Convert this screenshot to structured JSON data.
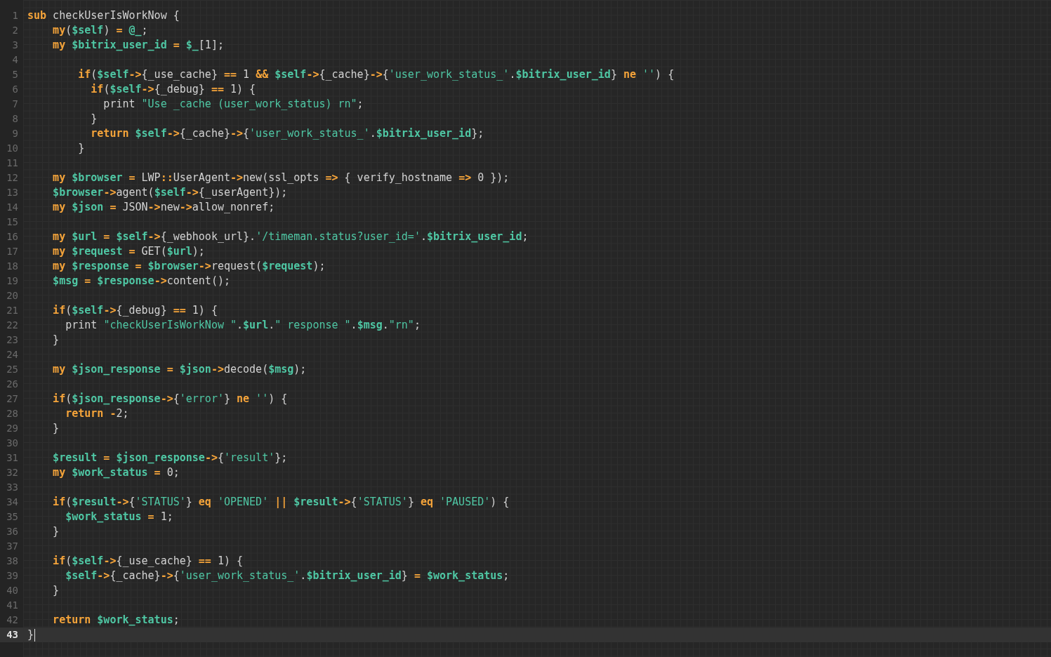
{
  "lines": [
    {
      "number": "1",
      "active": false,
      "tokens": [
        {
          "kind": "kw",
          "text": "sub"
        },
        {
          "kind": "text",
          "text": " checkUserIsWorkNow {"
        }
      ]
    },
    {
      "number": "2",
      "active": false,
      "tokens": [
        {
          "kind": "kw",
          "text": "    my"
        },
        {
          "kind": "text",
          "text": "("
        },
        {
          "kind": "var",
          "text": "$self"
        },
        {
          "kind": "text",
          "text": ") "
        },
        {
          "kind": "kw",
          "text": "="
        },
        {
          "kind": "var",
          "text": " @_"
        },
        {
          "kind": "text",
          "text": ";"
        }
      ]
    },
    {
      "number": "3",
      "active": false,
      "tokens": [
        {
          "kind": "kw",
          "text": "    my"
        },
        {
          "kind": "var",
          "text": " $bitrix_user_id"
        },
        {
          "kind": "kw",
          "text": " ="
        },
        {
          "kind": "var",
          "text": " $_"
        },
        {
          "kind": "text",
          "text": "[1];"
        }
      ]
    },
    {
      "number": "4",
      "active": false
    },
    {
      "number": "5",
      "active": false,
      "tokens": [
        {
          "kind": "kw",
          "text": "        if"
        },
        {
          "kind": "text",
          "text": "("
        },
        {
          "kind": "var",
          "text": "$self"
        },
        {
          "kind": "kw",
          "text": "->"
        },
        {
          "kind": "text",
          "text": "{_use_cache} "
        },
        {
          "kind": "kw",
          "text": "=="
        },
        {
          "kind": "text",
          "text": " 1 "
        },
        {
          "kind": "kw",
          "text": "&&"
        },
        {
          "kind": "var",
          "text": " $self"
        },
        {
          "kind": "kw",
          "text": "->"
        },
        {
          "kind": "text",
          "text": "{_cache}"
        },
        {
          "kind": "kw",
          "text": "->"
        },
        {
          "kind": "text",
          "text": "{"
        },
        {
          "kind": "str",
          "text": "'user_work_status_'"
        },
        {
          "kind": "text",
          "text": "."
        },
        {
          "kind": "var",
          "text": "$bitrix_user_id"
        },
        {
          "kind": "text",
          "text": "} "
        },
        {
          "kind": "kw",
          "text": "ne"
        },
        {
          "kind": "str",
          "text": " ''"
        },
        {
          "kind": "text",
          "text": ") {"
        }
      ]
    },
    {
      "number": "6",
      "active": false,
      "tokens": [
        {
          "kind": "kw",
          "text": "          if"
        },
        {
          "kind": "text",
          "text": "("
        },
        {
          "kind": "var",
          "text": "$self"
        },
        {
          "kind": "kw",
          "text": "->"
        },
        {
          "kind": "text",
          "text": "{_debug} "
        },
        {
          "kind": "kw",
          "text": "=="
        },
        {
          "kind": "text",
          "text": " 1) {"
        }
      ]
    },
    {
      "number": "7",
      "active": false,
      "tokens": [
        {
          "kind": "text",
          "text": "            print "
        },
        {
          "kind": "str",
          "text": "\"Use _cache (user_work_status) rn\""
        },
        {
          "kind": "text",
          "text": ";"
        }
      ]
    },
    {
      "number": "8",
      "active": false,
      "tokens": [
        {
          "kind": "text",
          "text": "          }"
        }
      ]
    },
    {
      "number": "9",
      "active": false,
      "tokens": [
        {
          "kind": "kw",
          "text": "          return"
        },
        {
          "kind": "var",
          "text": " $self"
        },
        {
          "kind": "kw",
          "text": "->"
        },
        {
          "kind": "text",
          "text": "{_cache}"
        },
        {
          "kind": "kw",
          "text": "->"
        },
        {
          "kind": "text",
          "text": "{"
        },
        {
          "kind": "str",
          "text": "'user_work_status_'"
        },
        {
          "kind": "text",
          "text": "."
        },
        {
          "kind": "var",
          "text": "$bitrix_user_id"
        },
        {
          "kind": "text",
          "text": "};"
        }
      ]
    },
    {
      "number": "10",
      "active": false,
      "tokens": [
        {
          "kind": "text",
          "text": "        }"
        }
      ]
    },
    {
      "number": "11",
      "active": false
    },
    {
      "number": "12",
      "active": false,
      "tokens": [
        {
          "kind": "kw",
          "text": "    my"
        },
        {
          "kind": "var",
          "text": " $browser"
        },
        {
          "kind": "kw",
          "text": " ="
        },
        {
          "kind": "text",
          "text": " LWP"
        },
        {
          "kind": "kw",
          "text": "::"
        },
        {
          "kind": "text",
          "text": "UserAgent"
        },
        {
          "kind": "kw",
          "text": "->"
        },
        {
          "kind": "text",
          "text": "new(ssl_opts "
        },
        {
          "kind": "kw",
          "text": "=>"
        },
        {
          "kind": "text",
          "text": " { verify_hostname "
        },
        {
          "kind": "kw",
          "text": "=>"
        },
        {
          "kind": "text",
          "text": " 0 });"
        }
      ]
    },
    {
      "number": "13",
      "active": false,
      "tokens": [
        {
          "kind": "var",
          "text": "    $browser"
        },
        {
          "kind": "kw",
          "text": "->"
        },
        {
          "kind": "text",
          "text": "agent("
        },
        {
          "kind": "var",
          "text": "$self"
        },
        {
          "kind": "kw",
          "text": "->"
        },
        {
          "kind": "text",
          "text": "{_userAgent});"
        }
      ]
    },
    {
      "number": "14",
      "active": false,
      "tokens": [
        {
          "kind": "kw",
          "text": "    my"
        },
        {
          "kind": "var",
          "text": " $json"
        },
        {
          "kind": "kw",
          "text": " ="
        },
        {
          "kind": "text",
          "text": " JSON"
        },
        {
          "kind": "kw",
          "text": "->"
        },
        {
          "kind": "text",
          "text": "new"
        },
        {
          "kind": "kw",
          "text": "->"
        },
        {
          "kind": "text",
          "text": "allow_nonref;"
        }
      ]
    },
    {
      "number": "15",
      "active": false
    },
    {
      "number": "16",
      "active": false,
      "tokens": [
        {
          "kind": "kw",
          "text": "    my"
        },
        {
          "kind": "var",
          "text": " $url"
        },
        {
          "kind": "kw",
          "text": " ="
        },
        {
          "kind": "var",
          "text": " $self"
        },
        {
          "kind": "kw",
          "text": "->"
        },
        {
          "kind": "text",
          "text": "{_webhook_url}."
        },
        {
          "kind": "str",
          "text": "'/timeman.status?user_id='"
        },
        {
          "kind": "text",
          "text": "."
        },
        {
          "kind": "var",
          "text": "$bitrix_user_id"
        },
        {
          "kind": "text",
          "text": ";"
        }
      ]
    },
    {
      "number": "17",
      "active": false,
      "tokens": [
        {
          "kind": "kw",
          "text": "    my"
        },
        {
          "kind": "var",
          "text": " $request"
        },
        {
          "kind": "kw",
          "text": " ="
        },
        {
          "kind": "text",
          "text": " GET("
        },
        {
          "kind": "var",
          "text": "$url"
        },
        {
          "kind": "text",
          "text": ");"
        }
      ]
    },
    {
      "number": "18",
      "active": false,
      "tokens": [
        {
          "kind": "kw",
          "text": "    my"
        },
        {
          "kind": "var",
          "text": " $response"
        },
        {
          "kind": "kw",
          "text": " ="
        },
        {
          "kind": "var",
          "text": " $browser"
        },
        {
          "kind": "kw",
          "text": "->"
        },
        {
          "kind": "text",
          "text": "request("
        },
        {
          "kind": "var",
          "text": "$request"
        },
        {
          "kind": "text",
          "text": ");"
        }
      ]
    },
    {
      "number": "19",
      "active": false,
      "tokens": [
        {
          "kind": "var",
          "text": "    $msg"
        },
        {
          "kind": "kw",
          "text": " ="
        },
        {
          "kind": "var",
          "text": " $response"
        },
        {
          "kind": "kw",
          "text": "->"
        },
        {
          "kind": "text",
          "text": "content();"
        }
      ]
    },
    {
      "number": "20",
      "active": false
    },
    {
      "number": "21",
      "active": false,
      "tokens": [
        {
          "kind": "kw",
          "text": "    if"
        },
        {
          "kind": "text",
          "text": "("
        },
        {
          "kind": "var",
          "text": "$self"
        },
        {
          "kind": "kw",
          "text": "->"
        },
        {
          "kind": "text",
          "text": "{_debug} "
        },
        {
          "kind": "kw",
          "text": "=="
        },
        {
          "kind": "text",
          "text": " 1) {"
        }
      ]
    },
    {
      "number": "22",
      "active": false,
      "tokens": [
        {
          "kind": "text",
          "text": "      print "
        },
        {
          "kind": "str",
          "text": "\"checkUserIsWorkNow \""
        },
        {
          "kind": "text",
          "text": "."
        },
        {
          "kind": "var",
          "text": "$url"
        },
        {
          "kind": "text",
          "text": "."
        },
        {
          "kind": "str",
          "text": "\" response \""
        },
        {
          "kind": "text",
          "text": "."
        },
        {
          "kind": "var",
          "text": "$msg"
        },
        {
          "kind": "text",
          "text": "."
        },
        {
          "kind": "str",
          "text": "\"rn\""
        },
        {
          "kind": "text",
          "text": ";"
        }
      ]
    },
    {
      "number": "23",
      "active": false,
      "tokens": [
        {
          "kind": "text",
          "text": "    }"
        }
      ]
    },
    {
      "number": "24",
      "active": false
    },
    {
      "number": "25",
      "active": false,
      "tokens": [
        {
          "kind": "kw",
          "text": "    my"
        },
        {
          "kind": "var",
          "text": " $json_response"
        },
        {
          "kind": "kw",
          "text": " ="
        },
        {
          "kind": "var",
          "text": " $json"
        },
        {
          "kind": "kw",
          "text": "->"
        },
        {
          "kind": "text",
          "text": "decode("
        },
        {
          "kind": "var",
          "text": "$msg"
        },
        {
          "kind": "text",
          "text": ");"
        }
      ]
    },
    {
      "number": "26",
      "active": false
    },
    {
      "number": "27",
      "active": false,
      "tokens": [
        {
          "kind": "kw",
          "text": "    if"
        },
        {
          "kind": "text",
          "text": "("
        },
        {
          "kind": "var",
          "text": "$json_response"
        },
        {
          "kind": "kw",
          "text": "->"
        },
        {
          "kind": "text",
          "text": "{"
        },
        {
          "kind": "str",
          "text": "'error'"
        },
        {
          "kind": "text",
          "text": "} "
        },
        {
          "kind": "kw",
          "text": "ne"
        },
        {
          "kind": "str",
          "text": " ''"
        },
        {
          "kind": "text",
          "text": ") {"
        }
      ]
    },
    {
      "number": "28",
      "active": false,
      "tokens": [
        {
          "kind": "kw",
          "text": "      return"
        },
        {
          "kind": "kw",
          "text": " -"
        },
        {
          "kind": "text",
          "text": "2;"
        }
      ]
    },
    {
      "number": "29",
      "active": false,
      "tokens": [
        {
          "kind": "text",
          "text": "    }"
        }
      ]
    },
    {
      "number": "30",
      "active": false
    },
    {
      "number": "31",
      "active": false,
      "tokens": [
        {
          "kind": "var",
          "text": "    $result"
        },
        {
          "kind": "kw",
          "text": " ="
        },
        {
          "kind": "var",
          "text": " $json_response"
        },
        {
          "kind": "kw",
          "text": "->"
        },
        {
          "kind": "text",
          "text": "{"
        },
        {
          "kind": "str",
          "text": "'result'"
        },
        {
          "kind": "text",
          "text": "};"
        }
      ]
    },
    {
      "number": "32",
      "active": false,
      "tokens": [
        {
          "kind": "kw",
          "text": "    my"
        },
        {
          "kind": "var",
          "text": " $work_status"
        },
        {
          "kind": "kw",
          "text": " ="
        },
        {
          "kind": "text",
          "text": " 0;"
        }
      ]
    },
    {
      "number": "33",
      "active": false
    },
    {
      "number": "34",
      "active": false,
      "tokens": [
        {
          "kind": "kw",
          "text": "    if"
        },
        {
          "kind": "text",
          "text": "("
        },
        {
          "kind": "var",
          "text": "$result"
        },
        {
          "kind": "kw",
          "text": "->"
        },
        {
          "kind": "text",
          "text": "{"
        },
        {
          "kind": "str",
          "text": "'STATUS'"
        },
        {
          "kind": "text",
          "text": "} "
        },
        {
          "kind": "kw",
          "text": "eq"
        },
        {
          "kind": "str",
          "text": " 'OPENED'"
        },
        {
          "kind": "kw",
          "text": " ||"
        },
        {
          "kind": "var",
          "text": " $result"
        },
        {
          "kind": "kw",
          "text": "->"
        },
        {
          "kind": "text",
          "text": "{"
        },
        {
          "kind": "str",
          "text": "'STATUS'"
        },
        {
          "kind": "text",
          "text": "} "
        },
        {
          "kind": "kw",
          "text": "eq"
        },
        {
          "kind": "str",
          "text": " 'PAUSED'"
        },
        {
          "kind": "text",
          "text": ") {"
        }
      ]
    },
    {
      "number": "35",
      "active": false,
      "tokens": [
        {
          "kind": "var",
          "text": "      $work_status"
        },
        {
          "kind": "kw",
          "text": " ="
        },
        {
          "kind": "text",
          "text": " 1;"
        }
      ]
    },
    {
      "number": "36",
      "active": false,
      "tokens": [
        {
          "kind": "text",
          "text": "    }"
        }
      ]
    },
    {
      "number": "37",
      "active": false
    },
    {
      "number": "38",
      "active": false,
      "tokens": [
        {
          "kind": "kw",
          "text": "    if"
        },
        {
          "kind": "text",
          "text": "("
        },
        {
          "kind": "var",
          "text": "$self"
        },
        {
          "kind": "kw",
          "text": "->"
        },
        {
          "kind": "text",
          "text": "{_use_cache} "
        },
        {
          "kind": "kw",
          "text": "=="
        },
        {
          "kind": "text",
          "text": " 1) {"
        }
      ]
    },
    {
      "number": "39",
      "active": false,
      "tokens": [
        {
          "kind": "var",
          "text": "      $self"
        },
        {
          "kind": "kw",
          "text": "->"
        },
        {
          "kind": "text",
          "text": "{_cache}"
        },
        {
          "kind": "kw",
          "text": "->"
        },
        {
          "kind": "text",
          "text": "{"
        },
        {
          "kind": "str",
          "text": "'user_work_status_'"
        },
        {
          "kind": "text",
          "text": "."
        },
        {
          "kind": "var",
          "text": "$bitrix_user_id"
        },
        {
          "kind": "text",
          "text": "} "
        },
        {
          "kind": "kw",
          "text": "="
        },
        {
          "kind": "var",
          "text": " $work_status"
        },
        {
          "kind": "text",
          "text": ";"
        }
      ]
    },
    {
      "number": "40",
      "active": false,
      "tokens": [
        {
          "kind": "text",
          "text": "    }"
        }
      ]
    },
    {
      "number": "41",
      "active": false
    },
    {
      "number": "42",
      "active": false,
      "tokens": [
        {
          "kind": "kw",
          "text": "    return"
        },
        {
          "kind": "var",
          "text": " $work_status"
        },
        {
          "kind": "text",
          "text": ";"
        }
      ]
    },
    {
      "number": "43",
      "active": true,
      "tokens": [
        {
          "kind": "text",
          "text": "}"
        }
      ]
    }
  ]
}
